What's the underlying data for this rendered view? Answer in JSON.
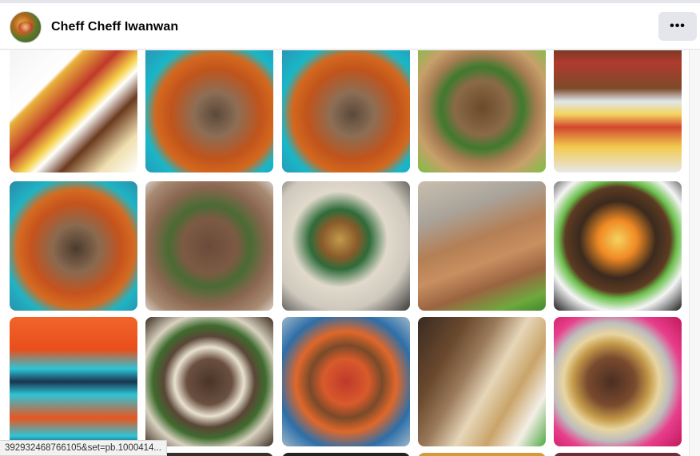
{
  "header": {
    "page_name": "Cheff Cheff Iwanwan",
    "more_label": "•••"
  },
  "grid": {
    "photos": [
      {
        "name": "photo-packed-meals-trays",
        "bg": "linear-gradient(135deg,#f3f3f3 0%,#fff 30%,#e9b23b 32%,#c0392b 45%,#f6d24a 55%,#fff 60%,#6b3a1f 70%,#f0e0b0 85%,#fff 100%)"
      },
      {
        "name": "photo-beef-noodle-soup-teal-bowl",
        "bg": "radial-gradient(circle at 55% 55%,#5a4a3a 0%,#8d6e55 22%,#c0541c 45%,#d4681e 60%,#19b7c8 72%,#2d8fb0 100%)"
      },
      {
        "name": "photo-beef-noodle-soup-teal-bowl-2",
        "bg": "radial-gradient(circle at 55% 55%,#5a4a3a 0%,#8d6e55 22%,#c0541c 45%,#d4681e 60%,#19b7c8 72%,#2d8fb0 100%)"
      },
      {
        "name": "photo-fried-noodles-scallions",
        "bg": "radial-gradient(circle at 50% 50%,#6b4a2a 0%,#8a6a47 30%,#3f7a2e 45%,#a67c52 60%,#c8a06a 75%,#7bc043 100%)"
      },
      {
        "name": "photo-omelette-rice-boxes",
        "bg": "linear-gradient(180deg,#5b3a22 0%,#b03a2e 15%,#7c4a2a 35%,#dfe7ec 45%,#f4d35e 55%,#d1462f 65%,#f2c94c 80%,#e8e8e8 100%)"
      },
      {
        "name": "photo-beef-noodle-soup-closeup",
        "bg": "radial-gradient(circle at 52% 52%,#4b3b2d 0%,#8a6a50 25%,#c6531d 48%,#d46b22 62%,#1fb4c4 75%,#2b89a9 100%)"
      },
      {
        "name": "photo-brown-broth-soup",
        "bg": "radial-gradient(circle at 50% 50%,#6a4b3a 0%,#7d5a44 30%,#4a6b34 45%,#8a6650 65%,#a88a72 85%,#d8d2cc 100%)"
      },
      {
        "name": "photo-creamy-soup-vegetables",
        "bg": "radial-gradient(circle at 45% 45%,#c29a4c 0%,#8a5b2a 18%,#2f6b3a 30%,#e0d9cc 48%,#cfc9bd 70%,#3a3a3a 100%)"
      },
      {
        "name": "photo-bagged-soups-green-table",
        "bg": "linear-gradient(160deg,#c9bfae 0%,#a9a39a 25%,#b47f55 45%,#c88f60 60%,#9a6440 75%,#6fa83e 90%,#3e8a2a 100%)"
      },
      {
        "name": "photo-rice-egg-carrot-box",
        "bg": "radial-gradient(circle at 50% 45%,#f4d35e 0%,#f08a24 20%,#3b2a1e 40%,#5c3b22 55%,#6abf4b 62%,#f5f5f5 75%,#1c1c1c 100%)"
      },
      {
        "name": "photo-tomato-soup-teal-bowls",
        "bg": "linear-gradient(180deg,#f0652a 0%,#e94e1b 25%,#2ec4d6 40%,#1a3550 50%,#2ec4d6 60%,#e9551f 78%,#2ec4d6 92%,#1a3550 100%)"
      },
      {
        "name": "photo-beansprout-beef-soup",
        "bg": "radial-gradient(circle at 50% 50%,#4a3528 0%,#6b5040 25%,#e9e2d0 38%,#5a4636 50%,#3f6b2e 62%,#d9d2c0 75%,#3a2a20 100%)"
      },
      {
        "name": "photo-spicy-beef-stew-bowl",
        "bg": "radial-gradient(circle at 50% 50%,#c0392b 0%,#d95a2b 25%,#7a4a2a 40%,#e0672a 55%,#2d6fa8 75%,#9fb7c9 100%)"
      },
      {
        "name": "photo-fried-rice-side-dishes",
        "bg": "linear-gradient(120deg,#3a2a22 0%,#6b4a2e 25%,#9a7a5a 40%,#e6d6b8 55%,#c9a46a 70%,#f3efe6 85%,#4fa844 100%)"
      },
      {
        "name": "photo-beef-dish-pink-tray",
        "bg": "radial-gradient(circle at 45% 50%,#4a2e22 0%,#7a4a2e 25%,#c49a4a 40%,#e8d5a0 50%,#bdbdbd 62%,#e83e8c 75%,#c2185b 100%)"
      }
    ],
    "partial_row": [
      {
        "name": "photo-partial-1",
        "bg": "#2a2a2a"
      },
      {
        "name": "photo-partial-2",
        "bg": "#3a2e28"
      },
      {
        "name": "photo-partial-3",
        "bg": "#222"
      },
      {
        "name": "photo-partial-4",
        "bg": "#d49a3a"
      },
      {
        "name": "photo-partial-5",
        "bg": "#6a2e3a"
      }
    ]
  },
  "status_bar": {
    "url": "392932468766105&set=pb.1000414..."
  }
}
